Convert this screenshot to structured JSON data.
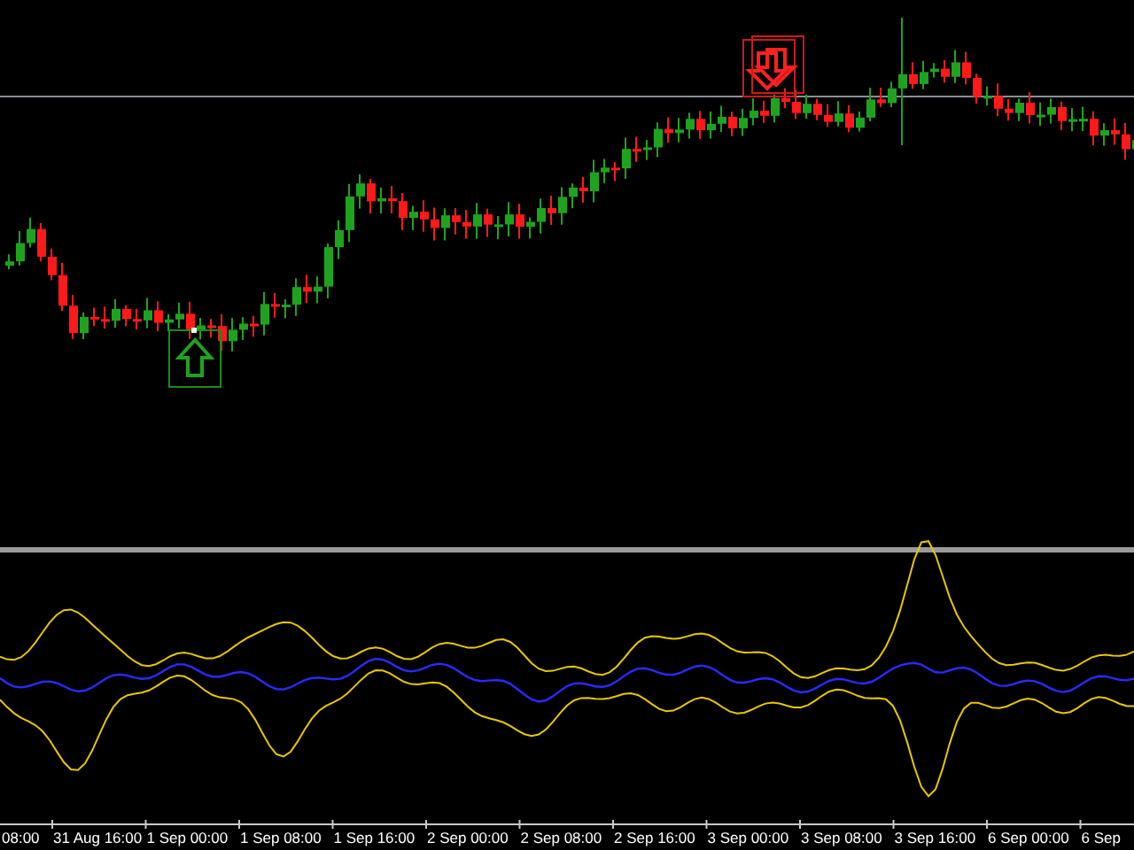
{
  "chart": {
    "signals": [
      {
        "kind": "buy"
      },
      {
        "kind": "sell"
      },
      {
        "kind": "sell"
      }
    ]
  },
  "time_axis": {
    "labels": [
      "08:00",
      "31 Aug 16:00",
      "1 Sep 00:00",
      "1 Sep 08:00",
      "1 Sep 16:00",
      "2 Sep 00:00",
      "2 Sep 08:00",
      "2 Sep 16:00",
      "3 Sep 00:00",
      "3 Sep 08:00",
      "3 Sep 16:00",
      "6 Sep 00:00",
      "6 Sep"
    ]
  }
}
